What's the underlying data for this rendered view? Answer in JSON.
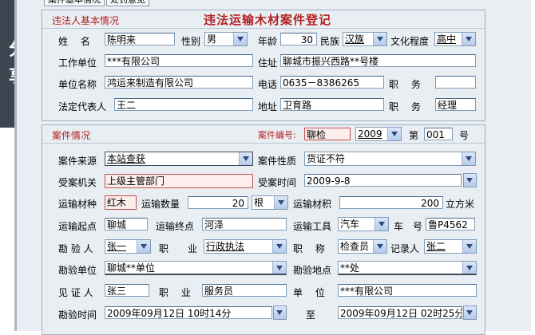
{
  "share": {
    "c1": "分",
    "c2": "享"
  },
  "tabs": [
    "案件基本情况",
    "处罚意见"
  ],
  "section1": {
    "title": "违法人基本情况",
    "form_title": "违法运输木材案件登记",
    "name_label": "姓　 名",
    "name": "陈明来",
    "gender_label": "性别",
    "gender": "男",
    "age_label": "年龄",
    "age": "30",
    "ethnic_label": "民族",
    "ethnic": "汉族",
    "edu_label": "文化程度",
    "edu": "高中",
    "work_label": "工作单位",
    "work": "***有限公司",
    "addr_label": "住址",
    "addr": "聊城市振兴西路**号楼",
    "unit_label": "单位名称",
    "unit": "鸿运来制造有限公司",
    "tel_label": "电话",
    "tel": "0635－8386265",
    "job_label": "职　 务",
    "job": "",
    "legal_label": "法定代表人",
    "legal": "王二",
    "addr2_label": "地址",
    "addr2": "卫育路",
    "job2_label": "职　 务",
    "job2": "经理"
  },
  "section2": {
    "title": "案件情况",
    "case_no_label": "案件编号:",
    "case_no": "聊检",
    "case_year": "2009",
    "di": "第",
    "num": "001",
    "hao": "号",
    "source_label": "案件来源",
    "source": "本站查获",
    "nature_label": "案件性质",
    "nature": "货证不符",
    "agency_label": "受案机关",
    "agency": "上级主管部门",
    "time_label": "受案时间",
    "time": "2009-9-8",
    "species_label": "运输材种",
    "species": "红木",
    "qty_label": "运输数量",
    "qty": "20",
    "qty_unit": "根",
    "vol_label": "运输材积",
    "vol": "200",
    "vol_unit": "立方米",
    "start_label": "运输起点",
    "start": "聊城",
    "end_label": "运输终点",
    "end": "河泽",
    "tool_label": "运输工具",
    "tool": "汽车",
    "plate_label": "车　号",
    "plate": "鲁P4562",
    "inspector_label": "勘 验 人",
    "inspector": "张一",
    "ijob_label": "职　　业",
    "ijob": "行政执法",
    "title_label": "职　 称",
    "ititle": "检查员",
    "recorder_label": "记录人",
    "recorder": "张二",
    "iunit_label": "勘验单位",
    "iunit": "聊城**单位",
    "iplace_label": "勘验地点",
    "iplace": "**处",
    "witness_label": "见 证 人",
    "witness": "张三",
    "wjob_label": "职　 业",
    "wjob": "服务员",
    "wunit_label": "单　 位",
    "wunit": "***有限公司",
    "itime_label": "勘验时间",
    "itime": "2009年09月12日 10时14分",
    "to_label": "至",
    "itime_end": "2009年09月12日 02时25分"
  }
}
